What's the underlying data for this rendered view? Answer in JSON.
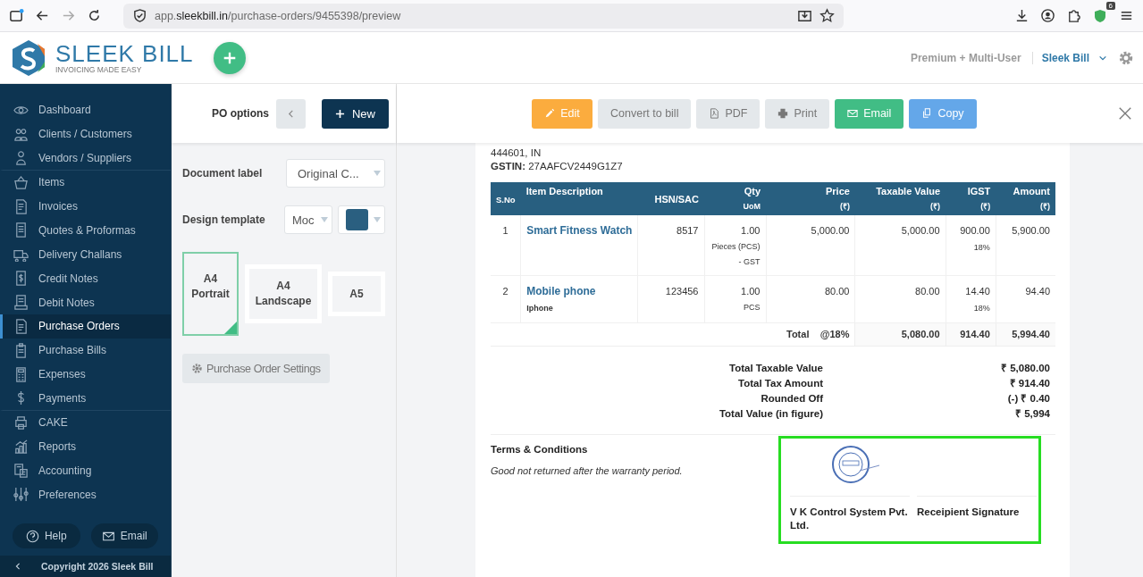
{
  "browser": {
    "url_host": "app.",
    "url_domain": "sleekbill.in",
    "url_path": "/purchase-orders/9455398/preview",
    "extension_badge": "6"
  },
  "header": {
    "logo_name": "SLEEK BILL",
    "logo_tagline": "INVOICING MADE EASY",
    "plan": "Premium + Multi-User",
    "company": "Sleek Bill"
  },
  "sidebar": {
    "items": [
      {
        "label": "Dashboard",
        "selected": false,
        "group_end": false
      },
      {
        "label": "Clients / Customers",
        "selected": false,
        "group_end": false
      },
      {
        "label": "Vendors / Suppliers",
        "selected": false,
        "group_end": true
      },
      {
        "label": "Items",
        "selected": false,
        "group_end": false
      },
      {
        "label": "Invoices",
        "selected": false,
        "group_end": false
      },
      {
        "label": "Quotes & Proformas",
        "selected": false,
        "group_end": false
      },
      {
        "label": "Delivery Challans",
        "selected": false,
        "group_end": false
      },
      {
        "label": "Credit Notes",
        "selected": false,
        "group_end": false
      },
      {
        "label": "Debit Notes",
        "selected": false,
        "group_end": false
      },
      {
        "label": "Purchase Orders",
        "selected": true,
        "group_end": false
      },
      {
        "label": "Purchase Bills",
        "selected": false,
        "group_end": false
      },
      {
        "label": "Expenses",
        "selected": false,
        "group_end": false
      },
      {
        "label": "Payments",
        "selected": false,
        "group_end": true
      },
      {
        "label": "CAKE",
        "selected": false,
        "group_end": false
      },
      {
        "label": "Reports",
        "selected": false,
        "group_end": false
      },
      {
        "label": "Accounting",
        "selected": false,
        "group_end": false
      },
      {
        "label": "Preferences",
        "selected": false,
        "group_end": false
      }
    ],
    "help": "Help",
    "email": "Email",
    "copyright": "Copyright 2026 Sleek Bill"
  },
  "options": {
    "title": "PO options",
    "new_button": "New",
    "document_label": "Document label",
    "document_value": "Original C...",
    "design_label": "Design template",
    "design_value": "Moc",
    "paper_sizes": [
      {
        "label": "A4 Portrait",
        "selected": true
      },
      {
        "label": "A4 Landscape",
        "selected": false
      },
      {
        "label": "A5",
        "selected": false
      }
    ],
    "settings_button": "Purchase Order Settings"
  },
  "toolbar": [
    {
      "label": "Edit",
      "kind": "edit"
    },
    {
      "label": "Convert to bill",
      "kind": "convert"
    },
    {
      "label": "PDF",
      "kind": "pdf"
    },
    {
      "label": "Print",
      "kind": "print"
    },
    {
      "label": "Email",
      "kind": "email"
    },
    {
      "label": "Copy",
      "kind": "copy"
    }
  ],
  "document": {
    "address_line": "444601, IN",
    "gstin_label": "GSTIN:",
    "gstin": "27AAFCV2449G1Z7",
    "columns": [
      {
        "label": "S.No"
      },
      {
        "label": "Item Description"
      },
      {
        "label": "HSN/SAC"
      },
      {
        "label": "Qty",
        "sub": "UoM"
      },
      {
        "label": "Price",
        "sub": "(₹)"
      },
      {
        "label": "Taxable Value",
        "sub": "(₹)"
      },
      {
        "label": "IGST",
        "sub": "(₹)"
      },
      {
        "label": "Amount",
        "sub": "(₹)"
      }
    ],
    "rows": [
      {
        "sno": "1",
        "item": "Smart Fitness Watch",
        "hsn": "8517",
        "qty": "1.00",
        "uom": "Pieces (PCS) - GST",
        "price": "5,000.00",
        "taxable": "5,000.00",
        "igst": "900.00",
        "rate": "18%",
        "amount": "5,900.00"
      },
      {
        "sno": "2",
        "item": "Mobile phone",
        "desc": "Iphone",
        "hsn": "123456",
        "qty": "1.00",
        "uom": "PCS",
        "price": "80.00",
        "taxable": "80.00",
        "igst": "14.40",
        "rate": "18%",
        "amount": "94.40"
      }
    ],
    "total_row": {
      "label": "Total",
      "rate": "@18%",
      "taxable": "5,080.00",
      "igst": "914.40",
      "amount": "5,994.40"
    },
    "summary": [
      {
        "label": "Total Taxable Value",
        "value": "₹ 5,080.00"
      },
      {
        "label": "Total Tax Amount",
        "value": "₹ 914.40"
      },
      {
        "label": "Rounded Off",
        "value": "(-) ₹ 0.40"
      },
      {
        "label": "Total Value (in figure)",
        "value": "₹ 5,994"
      }
    ],
    "terms_title": "Terms & Conditions",
    "terms_text": "Good not returned after the warranty period.",
    "signatory": "V K Control System Pvt. Ltd.",
    "recipient": "Receipient Signature"
  }
}
